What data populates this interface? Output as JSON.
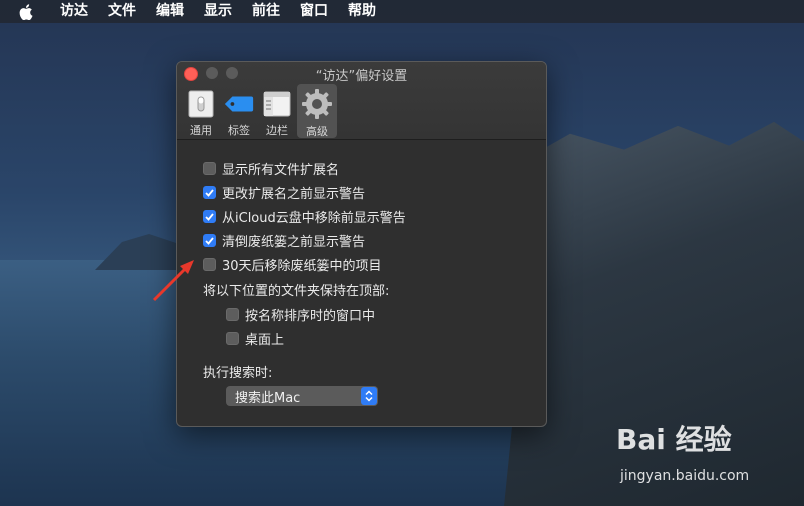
{
  "menubar": {
    "items": [
      "访达",
      "文件",
      "编辑",
      "显示",
      "前往",
      "窗口",
      "帮助"
    ]
  },
  "window": {
    "title": "“访达”偏好设置",
    "tabs": [
      {
        "label": "通用",
        "icon": "general-switch-icon",
        "active": false
      },
      {
        "label": "标签",
        "icon": "tag-icon",
        "active": false
      },
      {
        "label": "边栏",
        "icon": "sidebar-icon",
        "active": false
      },
      {
        "label": "高级",
        "icon": "gear-icon",
        "active": true
      }
    ],
    "options": [
      {
        "label": "显示所有文件扩展名",
        "checked": false
      },
      {
        "label": "更改扩展名之前显示警告",
        "checked": true
      },
      {
        "label": "从iCloud云盘中移除前显示警告",
        "checked": true
      },
      {
        "label": "清倒废纸篓之前显示警告",
        "checked": true
      },
      {
        "label": "30天后移除废纸篓中的项目",
        "checked": false
      }
    ],
    "keep_folders_heading": "将以下位置的文件夹保持在顶部:",
    "keep_folders_options": [
      {
        "label": "按名称排序时的窗口中",
        "checked": false
      },
      {
        "label": "桌面上",
        "checked": false
      }
    ],
    "search_heading": "执行搜索时:",
    "search_select": {
      "value": "搜索此Mac"
    }
  },
  "colors": {
    "accent": "#2f7cf6",
    "annotation": "#e8382b"
  },
  "watermark": {
    "brand": "Bai 经验",
    "url": "jingyan.baidu.com"
  }
}
